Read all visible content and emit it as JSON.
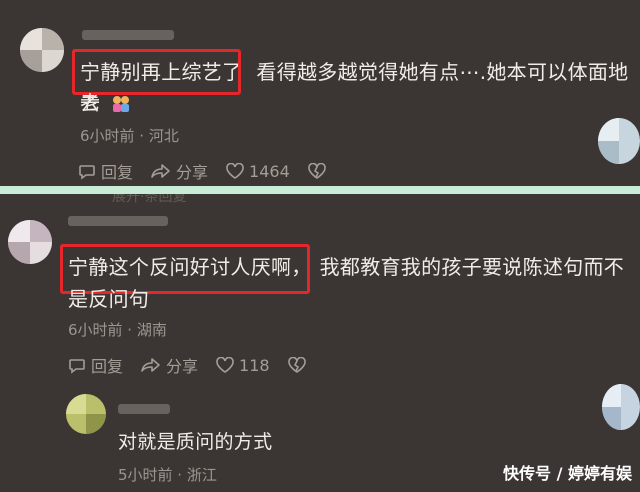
{
  "comment1": {
    "highlight_text": "宁静别再上综艺了",
    "rest_line1": "看得越多越觉得她有点⋯.她本可以体面地老",
    "line2": "去",
    "emoji": "couple-emoji",
    "meta": "6小时前 · 河北",
    "reply_label": "回复",
    "share_label": "分享",
    "like_count": "1464"
  },
  "comment2": {
    "highlight_text": "宁静这个反问好讨人厌啊，",
    "rest_line1": "我都教育我的孩子要说陈述句而不",
    "line2": "是反问句",
    "meta": "6小时前 · 湖南",
    "reply_label": "回复",
    "share_label": "分享",
    "like_count": "118"
  },
  "reply1": {
    "text": "对就是质问的方式",
    "meta": "5小时前 · 浙江"
  },
  "cut_text": "展开·条回复",
  "watermark": "快传号 / 婷婷有娱",
  "colors": {
    "highlight": "#e5262b",
    "divider": "#c9ecd7",
    "background": "#3b3633"
  }
}
